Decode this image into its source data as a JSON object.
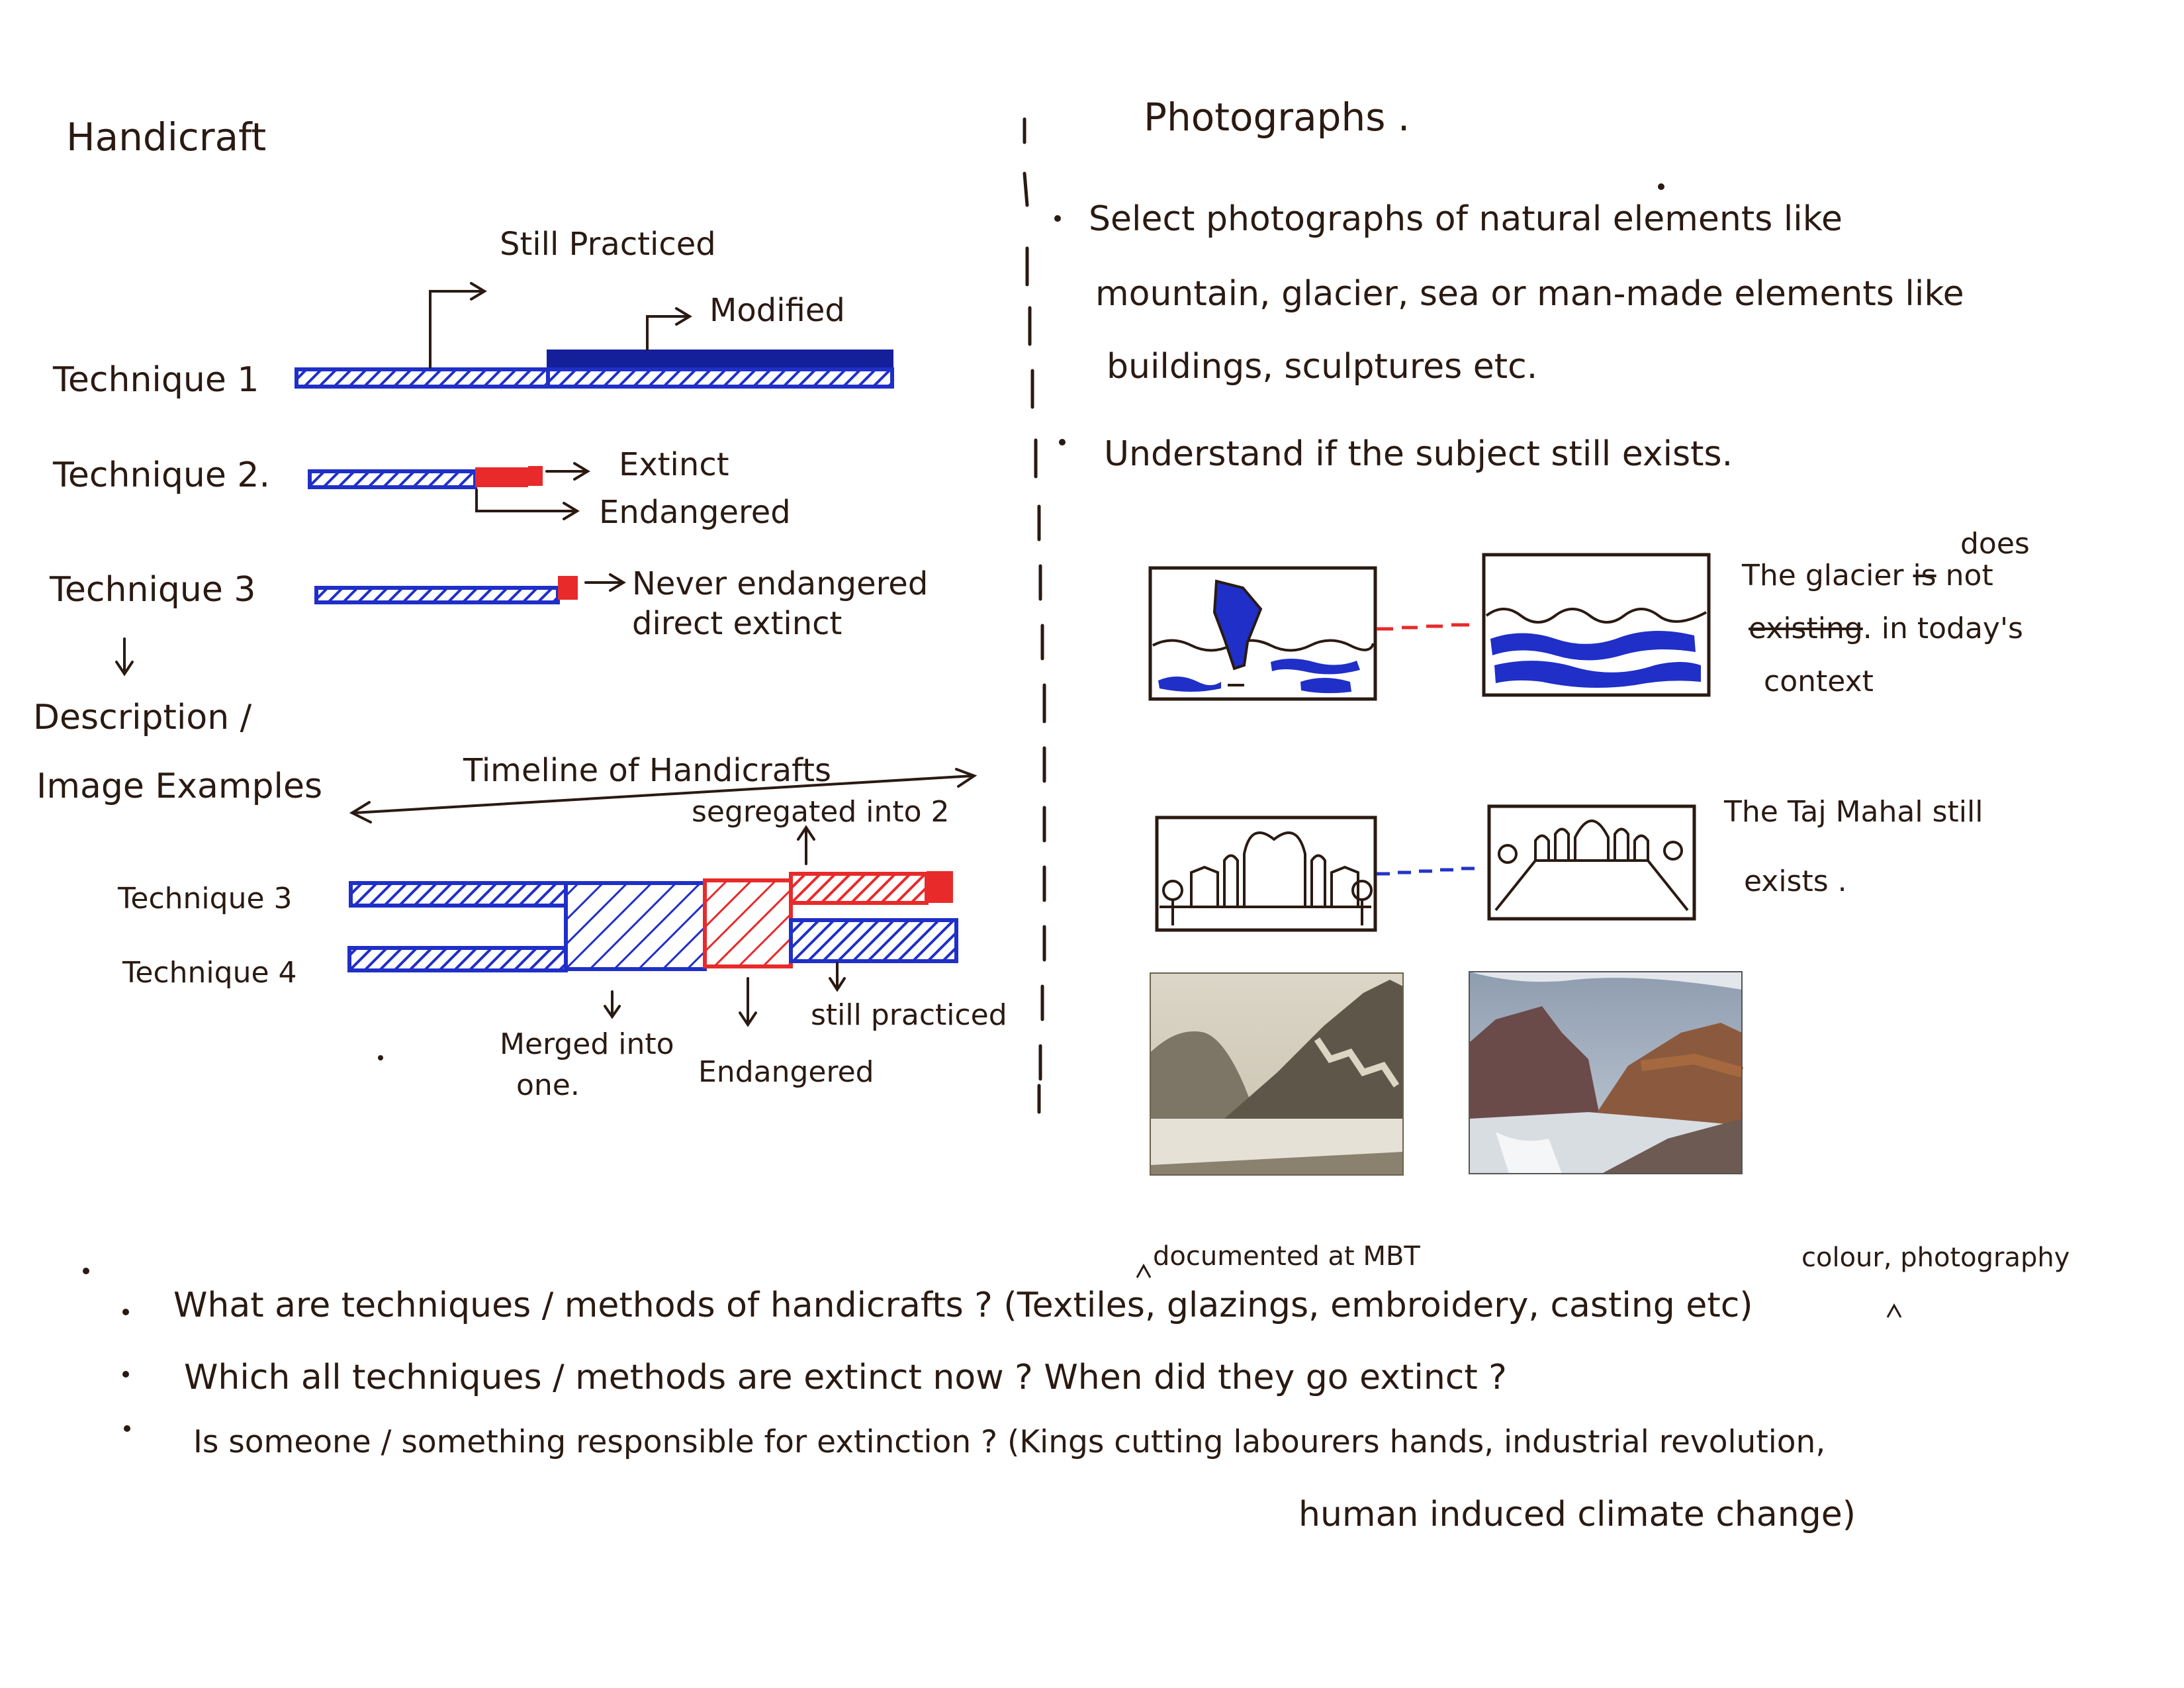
{
  "handicraft": {
    "title": "Handicraft",
    "still_practiced": "Still Practiced",
    "modified": "Modified",
    "technique1": "Technique 1",
    "technique2": "Technique 2.",
    "extinct": "Extinct",
    "endangered": "Endangered",
    "technique3": "Technique 3",
    "never_endangered": "Never endangered",
    "direct_extinct": "direct extinct",
    "description_line1": "Description /",
    "description_line2": "Image Examples",
    "timeline": "Timeline of Handicrafts",
    "segregated": "segregated into 2",
    "timeline_technique3": "Technique 3",
    "timeline_technique4": "Technique 4",
    "merged_line1": "Merged into",
    "merged_line2": "one.",
    "timeline_endangered": "Endangered",
    "timeline_still_practiced": "still practiced"
  },
  "photographs": {
    "title": "Photographs .",
    "bullet1_line1": "Select photographs of natural elements like",
    "bullet1_line2": "mountain, glacier, sea or man-made elements like",
    "bullet1_line3": "buildings, sculptures etc.",
    "bullet2": "Understand if the subject still exists.",
    "glacier_line1_a": "The glacier",
    "glacier_insert": "does",
    "glacier_struck": "is",
    "glacier_line1_b": "not",
    "glacier_line2_struck": "existing",
    "glacier_line2_b": ". in today's",
    "glacier_line3": "context",
    "taj_line1": "The Taj Mahal still",
    "taj_line2": "exists ."
  },
  "questions": {
    "q1_insert1": "documented at MBT",
    "q1_insert2": "colour, photography",
    "q1": "What are techniques / methods of handicrafts ? (Textiles, glazings, embroidery, casting etc)",
    "q2": "Which all techniques / methods are extinct now ? When did they go extinct ?",
    "q3_line1": "Is someone / something responsible for extinction ? (Kings cutting labourers hands, industrial revolution,",
    "q3_line2": "human induced climate change)"
  },
  "colors": {
    "ink": "#2a1a12",
    "blue": "#1f2fc8",
    "dark_blue": "#14209a",
    "red": "#e82a2a"
  }
}
